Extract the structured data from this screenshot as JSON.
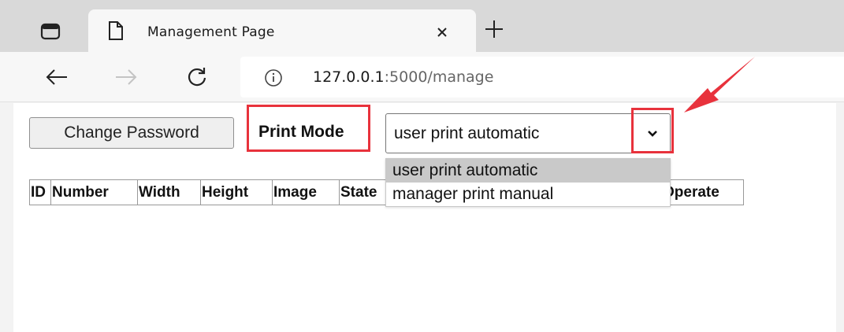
{
  "browser": {
    "tab": {
      "title": "Management Page"
    },
    "address_bar": {
      "host": "127.0.0.1",
      "rest": ":5000/manage"
    }
  },
  "page": {
    "change_password_label": "Change Password",
    "print_mode_label": "Print Mode",
    "print_mode_select": {
      "selected_value": "user print automatic",
      "options": [
        "user print automatic",
        "manager print manual"
      ]
    },
    "table": {
      "headers": [
        "ID",
        "Number",
        "Width",
        "Height",
        "Image",
        "State",
        "",
        "Operate"
      ]
    }
  },
  "annotations": {
    "highlight_color": "#e8323c"
  },
  "icons": [
    "sidebar-icon",
    "page-icon",
    "close-icon",
    "plus-icon",
    "back-arrow-icon",
    "forward-arrow-icon",
    "reload-icon",
    "info-icon",
    "chevron-down-icon",
    "annotation-arrow-icon"
  ]
}
